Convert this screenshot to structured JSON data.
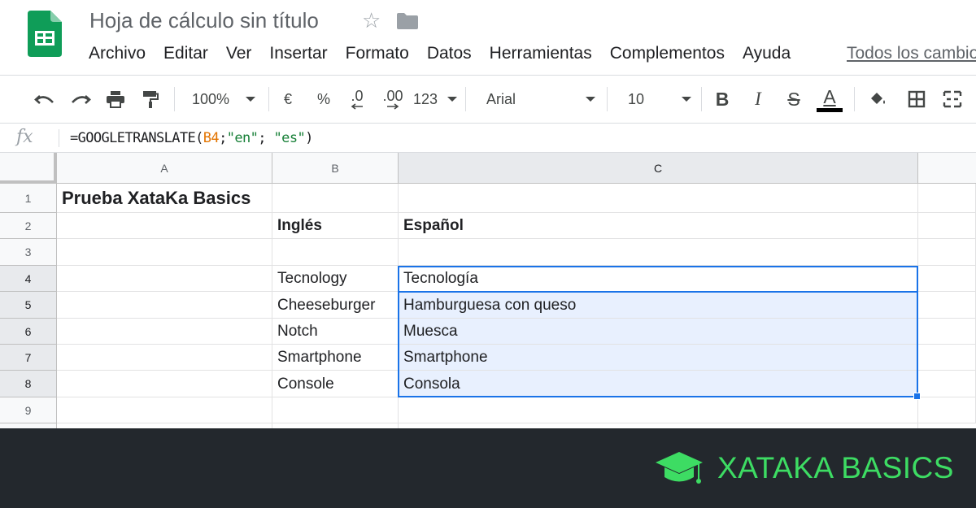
{
  "header": {
    "title": "Hoja de cálculo sin título",
    "star_icon": "star-icon",
    "folder_icon": "folder-icon",
    "save_status": "Todos los cambios",
    "menu": [
      "Archivo",
      "Editar",
      "Ver",
      "Insertar",
      "Formato",
      "Datos",
      "Herramientas",
      "Complementos",
      "Ayuda"
    ]
  },
  "toolbar": {
    "zoom": "100%",
    "currency": "€",
    "percent": "%",
    "decrease_decimals": ".0",
    "increase_decimals": ".00",
    "more_formats": "123",
    "font": "Arial",
    "font_size": "10",
    "bold": "B",
    "italic": "I",
    "strikethrough": "S",
    "text_color": "A"
  },
  "formula_bar": {
    "fx": "fx",
    "formula_prefix": "=GOOGLETRANSLATE(",
    "formula_ref": "B4",
    "formula_sep1": ";",
    "formula_arg1": "\"en\"",
    "formula_sep2": "; ",
    "formula_arg2": "\"es\"",
    "formula_suffix": ")"
  },
  "grid": {
    "columns": [
      "A",
      "B",
      "C"
    ],
    "rows": [
      "1",
      "2",
      "3",
      "4",
      "5",
      "6",
      "7",
      "8",
      "9"
    ],
    "cells": {
      "A1": "Prueba XataKa Basics",
      "B2": "Inglés",
      "C2": "Español",
      "B4": "Tecnology",
      "C4": "Tecnología",
      "B5": "Cheeseburger",
      "C5": "Hamburguesa con queso",
      "B6": "Notch",
      "C6": "Muesca",
      "B7": "Smartphone",
      "C7": "Smartphone",
      "B8": "Console",
      "C8": "Consola"
    },
    "selected_range": "C4:C8",
    "active_cell": "C4"
  },
  "footer": {
    "brand": "XATAKA BASICS",
    "brand_color": "#3ddc63",
    "background": "#23282d"
  },
  "colors": {
    "selection": "#1a73e8",
    "selection_fill": "#e8f0fe",
    "sheets_green": "#0f9d58"
  }
}
